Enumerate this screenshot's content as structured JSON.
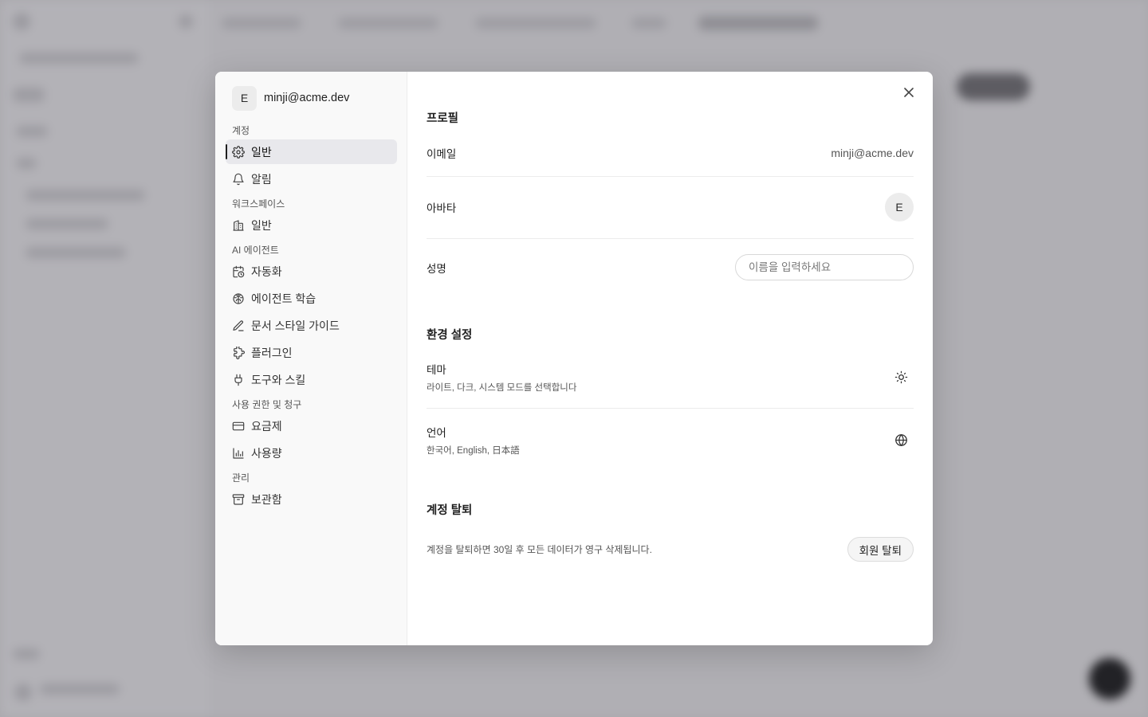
{
  "settings": {
    "user": {
      "initial": "E",
      "email": "minji@acme.dev"
    },
    "sections": [
      {
        "label": "계정",
        "items": [
          {
            "label": "일반",
            "icon": "gear-icon",
            "active": true
          },
          {
            "label": "알림",
            "icon": "bell-icon"
          }
        ]
      },
      {
        "label": "워크스페이스",
        "items": [
          {
            "label": "일반",
            "icon": "building-icon"
          }
        ]
      },
      {
        "label": "AI 에이전트",
        "items": [
          {
            "label": "자동화",
            "icon": "calendar-clock-icon"
          },
          {
            "label": "에이전트 학습",
            "icon": "brain-icon"
          },
          {
            "label": "문서 스타일 가이드",
            "icon": "pen-icon"
          },
          {
            "label": "플러그인",
            "icon": "puzzle-icon"
          },
          {
            "label": "도구와 스킬",
            "icon": "plug-icon"
          }
        ]
      },
      {
        "label": "사용 권한 및 청구",
        "items": [
          {
            "label": "요금제",
            "icon": "credit-card-icon"
          },
          {
            "label": "사용량",
            "icon": "bar-chart-icon"
          }
        ]
      },
      {
        "label": "관리",
        "items": [
          {
            "label": "보관함",
            "icon": "archive-icon"
          }
        ]
      }
    ]
  },
  "profile": {
    "title": "프로필",
    "email_label": "이메일",
    "email_value": "minji@acme.dev",
    "avatar_label": "아바타",
    "avatar_initial": "E",
    "name_label": "성명",
    "name_value": "",
    "name_placeholder": "이름을 입력하세요"
  },
  "preferences": {
    "title": "환경 설정",
    "theme_label": "테마",
    "theme_desc": "라이트, 다크, 시스템 모드를 선택합니다",
    "theme_icon": "sun-icon",
    "language_label": "언어",
    "language_desc": "한국어, English, 日本語",
    "language_icon": "globe-icon"
  },
  "deletion": {
    "title": "계정 탈퇴",
    "desc": "계정을 탈퇴하면 30일 후 모든 데이터가 영구 삭제됩니다.",
    "button": "회원 탈퇴"
  }
}
